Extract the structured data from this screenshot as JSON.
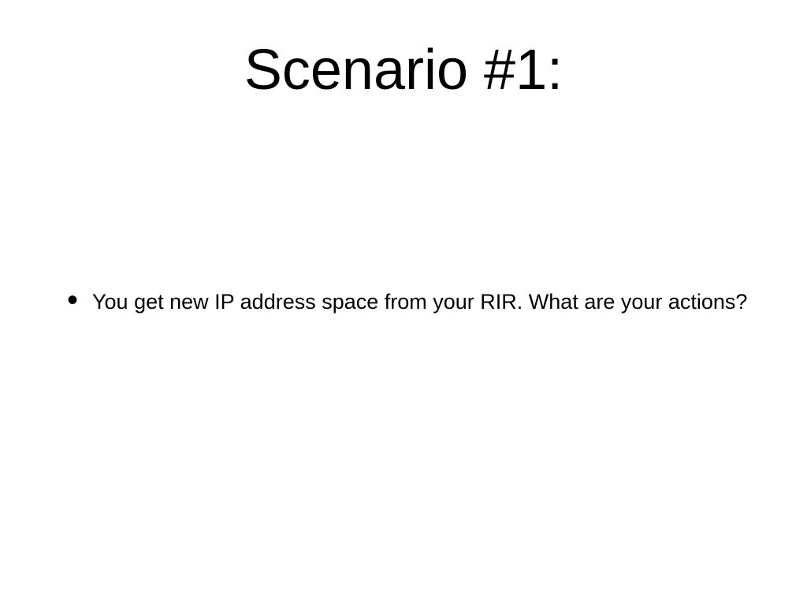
{
  "slide": {
    "title": "Scenario #1:",
    "bullets": [
      {
        "text": "You get new IP address space from your RIR.  What are your actions?"
      }
    ]
  }
}
